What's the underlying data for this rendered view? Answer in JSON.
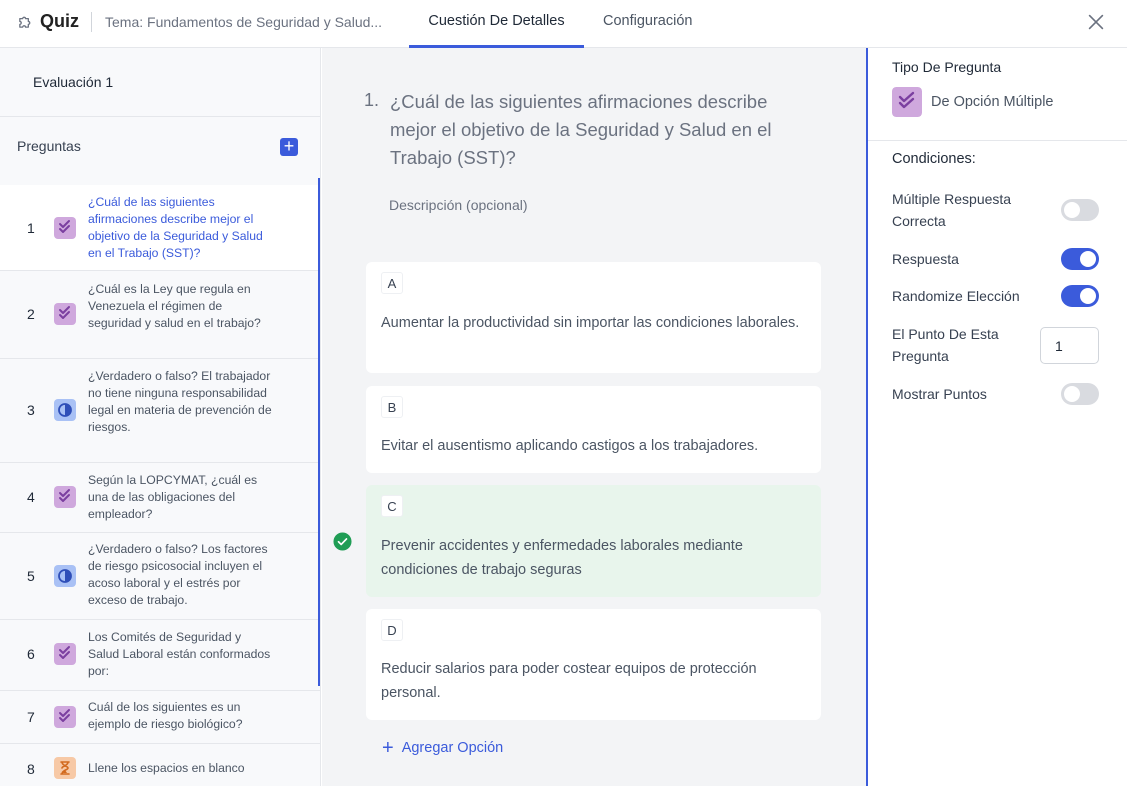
{
  "app": {
    "title": "Quiz",
    "topic": "Tema: Fundamentos de Seguridad y Salud...",
    "tabs": [
      {
        "label": "Cuestión De Detalles",
        "active": true
      },
      {
        "label": "Configuración",
        "active": false
      }
    ],
    "accent_color": "#3b5bdb"
  },
  "sidebar": {
    "evaluation_title": "Evaluación 1",
    "questions_label": "Preguntas",
    "questions": [
      {
        "number": "1",
        "icon": "multiple-choice-icon",
        "text": "¿Cuál de las siguientes afirmaciones describe mejor el objetivo de la Seguridad y Salud en el Trabajo (SST)?",
        "active": true
      },
      {
        "number": "2",
        "icon": "multiple-choice-icon",
        "text": "¿Cuál es la Ley que regula en Venezuela el régimen de seguridad y salud en el trabajo?"
      },
      {
        "number": "3",
        "icon": "true-false-icon",
        "text": "¿Verdadero o falso? El trabajador no tiene ninguna responsabilidad legal en materia de prevención de riesgos."
      },
      {
        "number": "4",
        "icon": "multiple-choice-icon",
        "text": "Según la LOPCYMAT, ¿cuál es una de las obligaciones del empleador?"
      },
      {
        "number": "5",
        "icon": "true-false-icon",
        "text": "¿Verdadero o falso? Los factores de riesgo psicosocial incluyen el acoso laboral y el estrés por exceso de trabajo."
      },
      {
        "number": "6",
        "icon": "multiple-choice-icon",
        "text": "Los Comités de Seguridad y Salud Laboral están conformados por:"
      },
      {
        "number": "7",
        "icon": "multiple-choice-icon",
        "text": "Cuál de los siguientes es un ejemplo de riesgo biológico?"
      },
      {
        "number": "8",
        "icon": "hourglass-icon",
        "text": "Llene los espacios en blanco"
      }
    ]
  },
  "question": {
    "number": "1.",
    "title": "¿Cuál de las siguientes afirmaciones describe mejor el objetivo de la Seguridad y Salud en el Trabajo (SST)?",
    "description_placeholder": "Descripción (opcional)",
    "options": [
      {
        "letter": "A",
        "text": "Aumentar la productividad sin importar las condiciones laborales.",
        "correct": false
      },
      {
        "letter": "B",
        "text": "Evitar el ausentismo aplicando castigos a los trabajadores.",
        "correct": false
      },
      {
        "letter": "C",
        "text": "Prevenir accidentes y enfermedades laborales mediante condiciones de trabajo seguras",
        "correct": true
      },
      {
        "letter": "D",
        "text": "Reducir salarios para poder costear equipos de protección personal.",
        "correct": false
      }
    ],
    "add_option_label": "Agregar Opción"
  },
  "settings": {
    "type_label": "Tipo De Pregunta",
    "type_value": "De Opción Múltiple",
    "conditions_label": "Condiciones:",
    "multiple_correct": {
      "label": "Múltiple Respuesta Correcta",
      "on": false
    },
    "answer": {
      "label": "Respuesta",
      "on": true
    },
    "randomize": {
      "label": "Randomize Elección",
      "on": true
    },
    "points": {
      "label": "El Punto De Esta Pregunta",
      "value": "1"
    },
    "show_points": {
      "label": "Mostrar Puntos",
      "on": false
    }
  }
}
